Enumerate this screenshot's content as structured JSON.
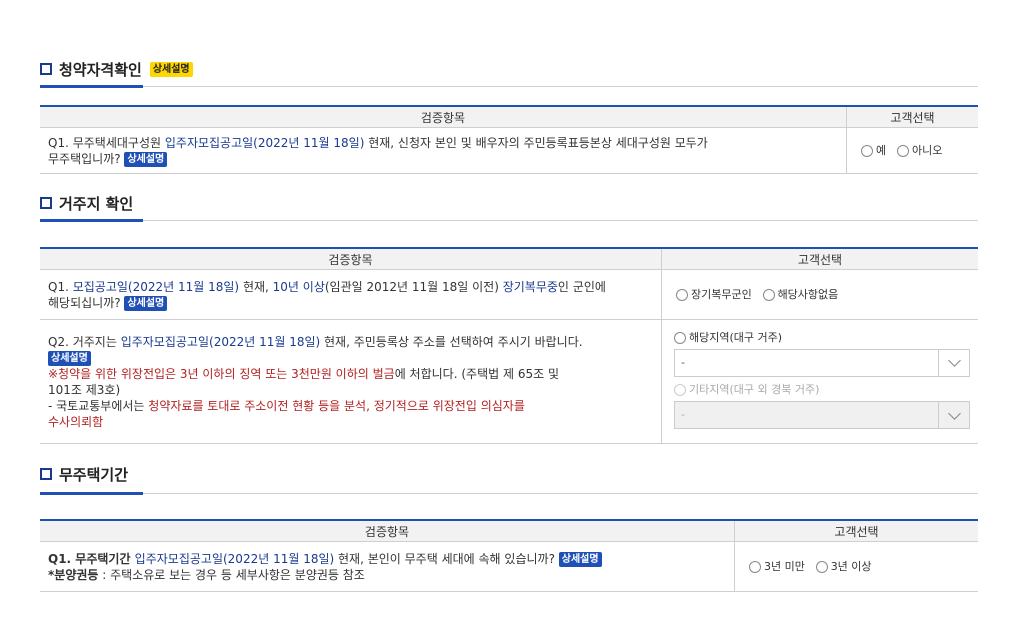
{
  "detail_label": "상세설명",
  "col_headers": {
    "item": "검증항목",
    "choice": "고객선택"
  },
  "s1": {
    "title": "청약자격확인",
    "q": {
      "prefix": "Q1. 무주택세대구성원 ",
      "link": "입주자모집공고일(2022년 11월 18일)",
      "rest": " 현재, 신청자 본인 및 배우자의 주민등록표등본상 세대구성원 모두가",
      "line2": "무주택입니까? "
    },
    "options": [
      "예",
      "아니오"
    ]
  },
  "s2": {
    "title": "거주지 확인",
    "q1": {
      "prefix": "Q1. ",
      "link1": "모집공고일(2022년 11월 18일)",
      "mid1": " 현재, ",
      "link2": "10년 이상",
      "mid2": "(임관일 2012년 11월 18일 이전) ",
      "link3": "장기복무중",
      "rest": "인 군인에",
      "line2": "해당되십니까? "
    },
    "q1_options": [
      "장기복무군인",
      "해당사항없음"
    ],
    "q2": {
      "prefix": "Q2. 거주지는 ",
      "link": "입주자모집공고일(2022년 11월 18일)",
      "rest": " 현재, 주민등록상 주소를 선택하여 주시기 바랍니다.",
      "warn_red1": "※청약을 위한 위장전입은 3년 이하의 징역 또는 3천만원 이하의 벌금",
      "warn_rest": "에 처합니다. (주택법 제 65조 및",
      "warn_line2": "101조 제3호)",
      "note_prefix": "- 국토교통부에서는 ",
      "note_red": "청약자료를 토대로 주소이전 현황 등을 분석, 정기적으로 위장전입 의심자를",
      "note_red2": "수사의뢰함"
    },
    "q2_choice1": "해당지역(대구 거주)",
    "q2_select1": "-",
    "q2_choice2": "기타지역(대구 외 경북 거주)",
    "q2_select2": "-"
  },
  "s3": {
    "title": "무주택기간",
    "q": {
      "prefix": "Q1. 무주택기간 ",
      "link": "입주자모집공고일(2022년 11월 18일)",
      "rest": " 현재, 본인이 무주택 세대에 속해 있습니까? ",
      "note_bold": "*분양권등",
      "note_rest": " : 주택소유로 보는 경우 등 세부사항은 분양권등 참조"
    },
    "options": [
      "3년 미만",
      "3년 이상"
    ]
  }
}
